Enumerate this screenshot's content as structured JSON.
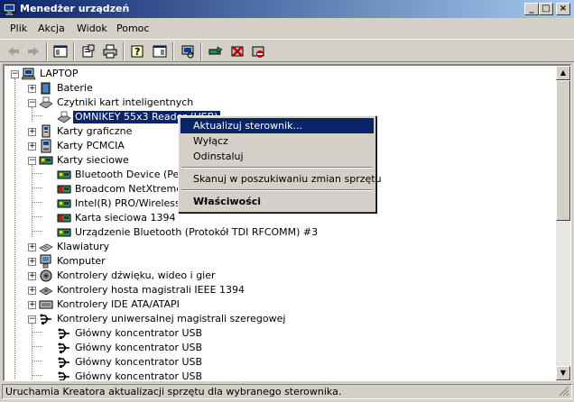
{
  "window": {
    "title": "Menedżer urządzeń",
    "minimize": "_",
    "maximize": "□",
    "close": "×"
  },
  "menu": [
    "Plik",
    "Akcja",
    "Widok",
    "Pomoc"
  ],
  "tree": {
    "root": "LAPTOP",
    "items": [
      {
        "label": "Baterie",
        "icon": "battery-icon"
      },
      {
        "label": "Czytniki kart inteligentnych",
        "icon": "smartcard-reader-icon"
      },
      {
        "label": "OMNIKEY 55x3 Reader (USB)",
        "icon": "smartcard-reader-icon"
      },
      {
        "label": "Karty graficzne",
        "icon": "display-adapter-icon"
      },
      {
        "label": "Karty PCMCIA",
        "icon": "pcmcia-icon"
      },
      {
        "label": "Karty sieciowe",
        "icon": "network-card-icon"
      },
      {
        "label": "Bluetooth Device (Personal Area Network)",
        "icon": "network-card-icon"
      },
      {
        "label": "Broadcom NetXtreme Gigabit Ethernet",
        "icon": "network-card-disabled-icon"
      },
      {
        "label": "Intel(R) PRO/Wireless 2200BG Network Connection",
        "icon": "network-card-icon"
      },
      {
        "label": "Karta sieciowa 1394",
        "icon": "network-card-disabled-icon"
      },
      {
        "label": "Urządzenie Bluetooth (Protokół TDI RFCOMM) #3",
        "icon": "network-card-icon"
      },
      {
        "label": "Klawiatury",
        "icon": "keyboard-icon"
      },
      {
        "label": "Komputer",
        "icon": "computer-icon"
      },
      {
        "label": "Kontrolery dźwięku, wideo i gier",
        "icon": "sound-icon"
      },
      {
        "label": "Kontrolery hosta magistrali IEEE 1394",
        "icon": "ieee1394-icon"
      },
      {
        "label": "Kontrolery IDE ATA/ATAPI",
        "icon": "ide-controller-icon"
      },
      {
        "label": "Kontrolery uniwersalnej magistrali szeregowej",
        "icon": "usb-icon"
      },
      {
        "label": "Główny koncentrator USB",
        "icon": "usb-icon"
      },
      {
        "label": "Główny koncentrator USB",
        "icon": "usb-icon"
      },
      {
        "label": "Główny koncentrator USB",
        "icon": "usb-icon"
      },
      {
        "label": "Główny koncentrator USB",
        "icon": "usb-icon"
      }
    ]
  },
  "context_menu": {
    "update": "Aktualizuj sterownik...",
    "disable": "Wyłącz",
    "uninstall": "Odinstaluj",
    "scan": "Skanuj w poszukiwaniu zmian sprzętu",
    "properties": "Właściwości"
  },
  "status": "Uruchamia Kreatora aktualizacji sprzętu dla wybranego sterownika.",
  "colors": {
    "titlebar": "#0a246a",
    "selection": "#0a246a",
    "face": "#d4d0c8"
  }
}
